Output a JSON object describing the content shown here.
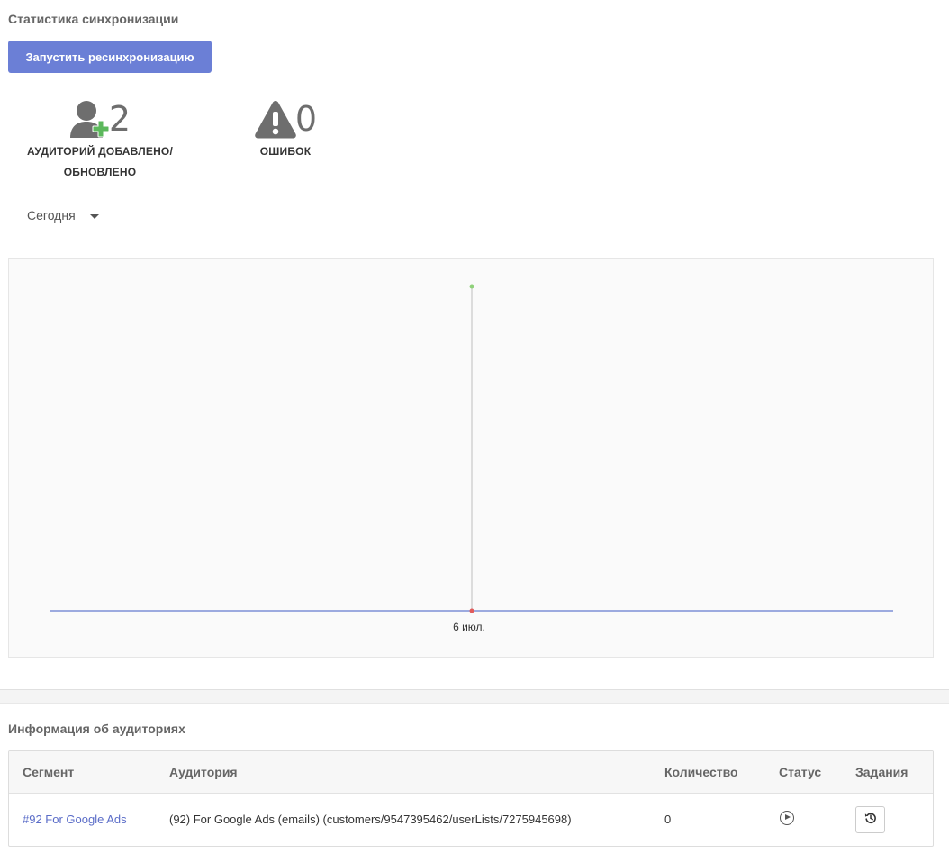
{
  "sync": {
    "title": "Статистика синхронизации",
    "resync_label": "Запустить ресинхронизацию"
  },
  "stats": {
    "audiences": {
      "value": "2",
      "label_line1": "АУДИТОРИЙ ДОБАВЛЕНО/",
      "label_line2": "ОБНОВЛЕНО",
      "icon": "user-plus-icon"
    },
    "errors": {
      "value": "0",
      "label": "ОШИБОК",
      "icon": "warning-icon"
    }
  },
  "period": {
    "selected": "Сегодня"
  },
  "chart_data": {
    "type": "line",
    "x": [
      "6 июл."
    ],
    "series": [
      {
        "values": [
          2
        ],
        "color": "#8fd17a"
      },
      {
        "values": [
          0
        ],
        "color": "#e05b5b"
      }
    ],
    "ylim": [
      0,
      2
    ],
    "grid": false
  },
  "chart_colors": {
    "baseline": "#7d8fd6",
    "marker_line": "#bdbdbd"
  },
  "info": {
    "title": "Информация об аудиториях",
    "columns": [
      "Сегмент",
      "Аудитория",
      "Количество",
      "Статус",
      "Задания"
    ],
    "rows": [
      {
        "segment": "#92 For Google Ads",
        "audience": "(92) For Google Ads (emails) (customers/9547395462/userLists/7275945698)",
        "count": "0",
        "status_icon": "play-circle-icon",
        "task_icon": "history-icon"
      }
    ]
  },
  "colors": {
    "accent": "#6b7fd6",
    "link": "#5b6dc8"
  }
}
